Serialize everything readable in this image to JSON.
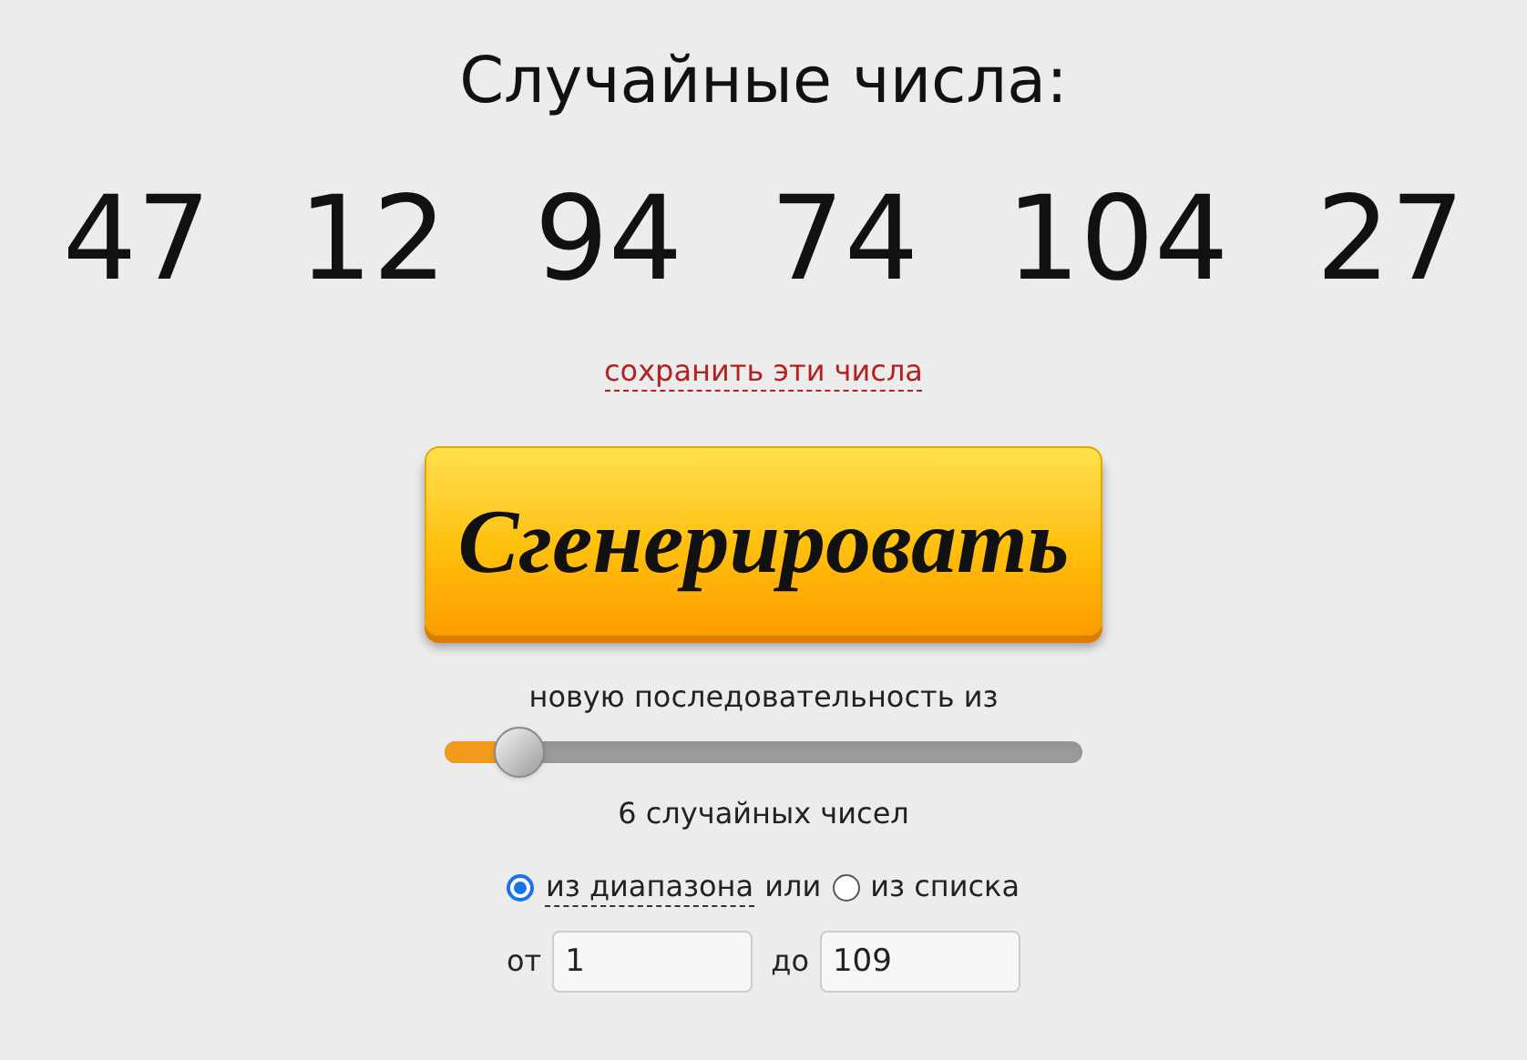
{
  "title": "Случайные числа:",
  "numbers": [
    "47",
    "12",
    "94",
    "74",
    "104",
    "27"
  ],
  "save_link": "сохранить эти числа",
  "generate_button": "Сгенерировать",
  "sequence_label": "новую последовательность из",
  "count_slider": {
    "level": 0.1
  },
  "count_label": "6 случайных чисел",
  "source_options": [
    {
      "label": "из диапазона",
      "selected": true
    },
    {
      "label": "из списка",
      "selected": false
    }
  ],
  "source_separator": "или",
  "range": {
    "from_label": "от",
    "from_value": "1",
    "to_label": "до",
    "to_value": "109"
  }
}
